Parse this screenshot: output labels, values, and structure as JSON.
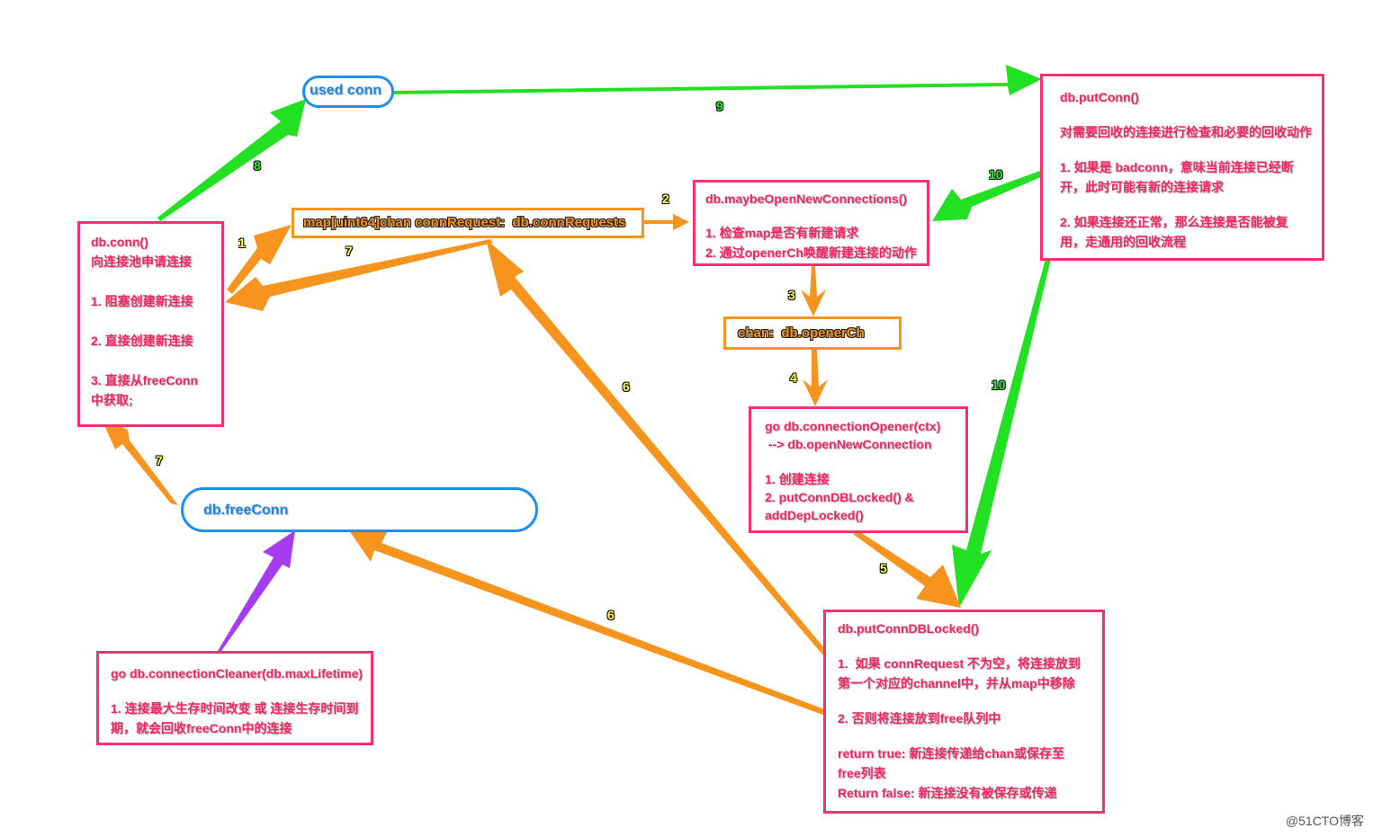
{
  "colors": {
    "pink_box": "#fb2f6f",
    "pink_text": "#f2275f",
    "orange": "#f7941d",
    "blue": "#1e8ff0",
    "green": "#22e022",
    "purple": "#a63cf0",
    "step_yellow": "#ffff3a",
    "step_green": "#2cf02c"
  },
  "nodes": {
    "used_conn": {
      "label": "used conn"
    },
    "db_conn": {
      "title": "db.conn()",
      "subtitle": "向连接池申请连接",
      "items": [
        "1. 阻塞创建新连接",
        "2. 直接创建新连接",
        "3. 直接从freeConn",
        "中获取;"
      ]
    },
    "conn_requests": {
      "label": "map[uint64]chan connRequest:  db.connRequests"
    },
    "maybe_open": {
      "title": "db.maybeOpenNewConnections()",
      "items": [
        "1. 检查map是否有新建请求",
        "2. 通过openerCh唤醒新建连接的动作"
      ]
    },
    "put_conn": {
      "title": "db.putConn()",
      "subtitle": "对需要回收的连接进行检查和必要的回收动作",
      "items": [
        "1. 如果是 badconn，意味当前连接已经断",
        "开，此时可能有新的连接请求",
        "2. 如果连接还正常，那么连接是否能被复",
        "用，走通用的回收流程"
      ]
    },
    "opener_ch": {
      "label": "chan:  db.openerCh"
    },
    "connection_opener": {
      "title": "go db.connectionOpener(ctx)",
      "subtitle": " --> db.openNewConnection",
      "items": [
        "1. 创建连接",
        "2. putConnDBLocked() &",
        "addDepLocked()"
      ]
    },
    "free_conn": {
      "label": "db.freeConn"
    },
    "put_conn_db_locked": {
      "title": "db.putConnDBLocked()",
      "items": [
        "1.  如果 connRequest 不为空，将连接放到",
        "第一个对应的channel中，并从map中移除",
        "2. 否则将连接放到free队列中",
        "return true: 新连接传递给chan或保存至",
        "free列表",
        "Return false: 新连接没有被保存或传递"
      ]
    },
    "connection_cleaner": {
      "title": "go db.connectionCleaner(db.maxLifetime)",
      "items": [
        "1. 连接最大生存时间改变 或 连接生存时间到",
        "期，就会回收freeConn中的连接"
      ]
    }
  },
  "edges": [
    {
      "step": "1",
      "from": "db_conn",
      "to": "conn_requests",
      "color": "orange"
    },
    {
      "step": "2",
      "from": "conn_requests",
      "to": "maybe_open",
      "color": "orange"
    },
    {
      "step": "3",
      "from": "maybe_open",
      "to": "opener_ch",
      "color": "orange"
    },
    {
      "step": "4",
      "from": "opener_ch",
      "to": "connection_opener",
      "color": "orange"
    },
    {
      "step": "5",
      "from": "connection_opener",
      "to": "put_conn_db_locked",
      "color": "orange"
    },
    {
      "step": "6",
      "from": "put_conn_db_locked",
      "to": "conn_requests",
      "color": "orange"
    },
    {
      "step": "6",
      "from": "put_conn_db_locked",
      "to": "free_conn",
      "color": "orange"
    },
    {
      "step": "7",
      "from": "conn_requests",
      "to": "db_conn",
      "color": "orange"
    },
    {
      "step": "7",
      "from": "free_conn",
      "to": "db_conn",
      "color": "orange"
    },
    {
      "step": "8",
      "from": "db_conn",
      "to": "used_conn",
      "color": "green"
    },
    {
      "step": "9",
      "from": "used_conn",
      "to": "put_conn",
      "color": "green"
    },
    {
      "step": "10",
      "from": "put_conn",
      "to": "maybe_open",
      "color": "green"
    },
    {
      "step": "10",
      "from": "put_conn",
      "to": "put_conn_db_locked",
      "color": "green"
    },
    {
      "step": "",
      "from": "connection_cleaner",
      "to": "free_conn",
      "color": "purple"
    }
  ],
  "watermark": "@51CTO博客"
}
